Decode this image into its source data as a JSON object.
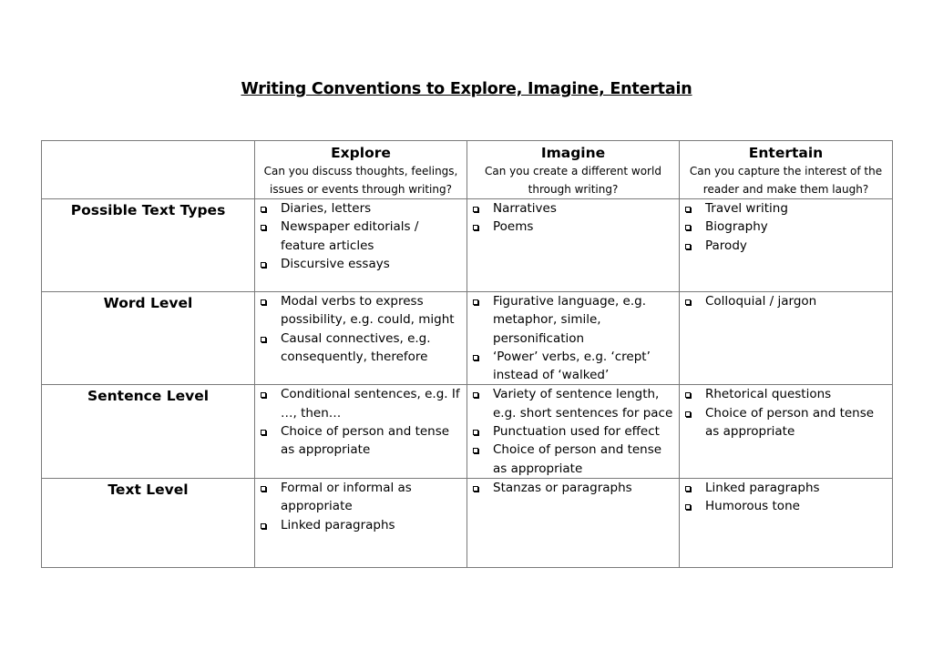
{
  "title": "Writing Conventions to Explore, Imagine, Entertain",
  "columns": [
    {
      "heading": "Explore",
      "question": "Can you discuss thoughts, feelings, issues or events through writing?"
    },
    {
      "heading": "Imagine",
      "question": "Can you create a different world through writing?"
    },
    {
      "heading": "Entertain",
      "question": "Can you capture the interest of the reader and make them laugh?"
    }
  ],
  "rows": [
    {
      "label": "Possible Text Types",
      "cells": [
        [
          "Diaries, letters",
          "Newspaper editorials / feature articles",
          "Discursive essays"
        ],
        [
          "Narratives",
          "Poems"
        ],
        [
          "Travel writing",
          "Biography",
          "Parody"
        ]
      ]
    },
    {
      "label": "Word Level",
      "cells": [
        [
          "Modal verbs to express possibility, e.g. could, might",
          "Causal connectives, e.g. consequently, therefore"
        ],
        [
          "Figurative language, e.g. metaphor, simile, personification",
          "‘Power’ verbs, e.g. ‘crept’ instead of ‘walked’"
        ],
        [
          "Colloquial / jargon"
        ]
      ]
    },
    {
      "label": "Sentence Level",
      "cells": [
        [
          "Conditional sentences, e.g. If …, then…",
          "Choice of person and tense as appropriate"
        ],
        [
          "Variety of sentence length, e.g. short sentences for pace",
          "Punctuation used for effect",
          "Choice of person and tense as appropriate"
        ],
        [
          "Rhetorical questions",
          "Choice of person and tense as appropriate"
        ]
      ]
    },
    {
      "label": "Text Level",
      "cells": [
        [
          "Formal or informal as appropriate",
          "Linked paragraphs"
        ],
        [
          "Stanzas or paragraphs"
        ],
        [
          "Linked paragraphs",
          "Humorous tone"
        ]
      ]
    }
  ]
}
